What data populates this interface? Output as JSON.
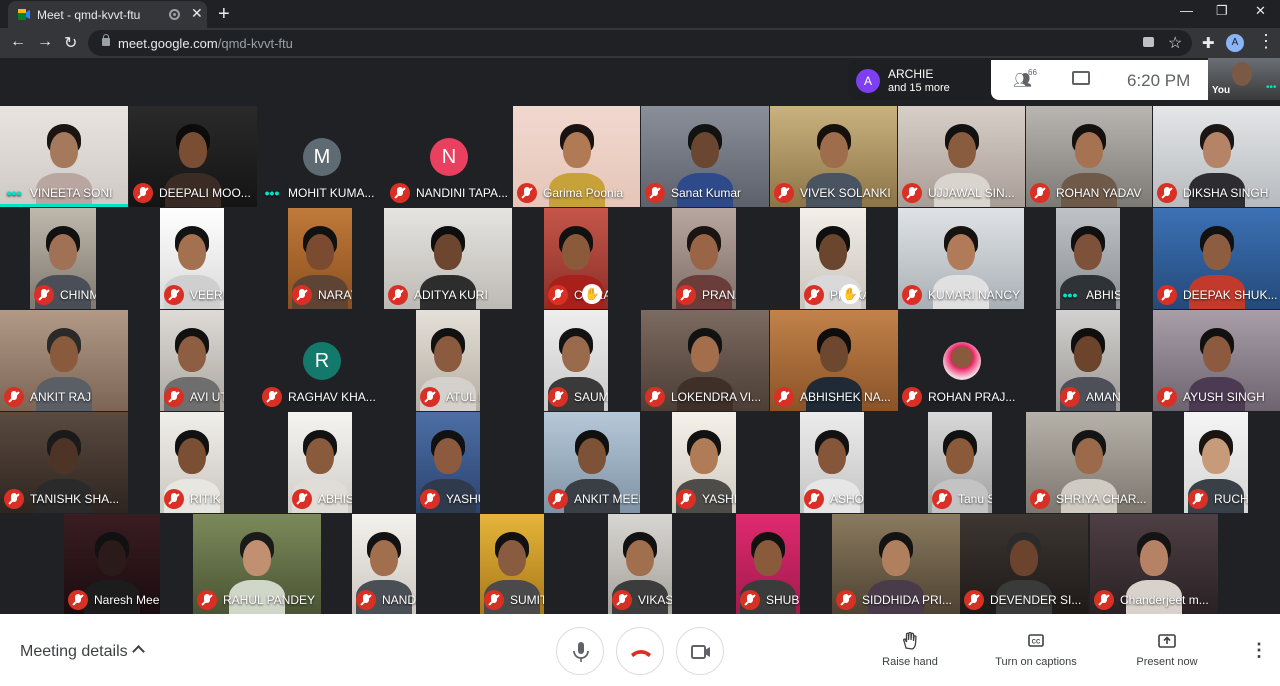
{
  "browser": {
    "tab_title": "Meet - qmd-kvvt-ftu",
    "tab_close": "✕",
    "new_tab": "+",
    "url_host": "meet.google.com",
    "url_path": "/qmd-kvvt-ftu",
    "profile_initial": "A",
    "window_min": "—",
    "window_max": "❐",
    "window_close": "✕"
  },
  "meet": {
    "presenter_initial": "A",
    "presenter_name": "ARCHIE",
    "presenter_more": "and 15 more",
    "participant_count": "66",
    "time": "6:20 PM",
    "self_label": "You",
    "accent": "#00e3c6",
    "muted_color": "#d93025"
  },
  "participants": [
    {
      "name": "VINEETA SONI",
      "status": "speaking"
    },
    {
      "name": "DEEPALI MOO...",
      "status": "muted"
    },
    {
      "name": "MOHIT KUMA...",
      "status": "speaking",
      "initial": "M"
    },
    {
      "name": "NANDINI TAPA...",
      "status": "muted",
      "initial": "N"
    },
    {
      "name": "Garima Poonia",
      "status": "muted"
    },
    {
      "name": "Sanat Kumar",
      "status": "muted"
    },
    {
      "name": "VIVEK SOLANKI",
      "status": "muted"
    },
    {
      "name": "UJJAWAL SIN...",
      "status": "muted"
    },
    {
      "name": "ROHAN YADAV",
      "status": "muted"
    },
    {
      "name": "DIKSHA SINGH",
      "status": "muted"
    },
    {
      "name": "CHINMAYA SI...",
      "status": "muted"
    },
    {
      "name": "VEERU SINGH",
      "status": "muted"
    },
    {
      "name": "NARAYAN TELI",
      "status": "muted"
    },
    {
      "name": "ADITYA KURI",
      "status": "muted"
    },
    {
      "name": "CHIRAYU ...",
      "status": "muted",
      "hand": true
    },
    {
      "name": "PRANAV SHA...",
      "status": "muted"
    },
    {
      "name": "PRAKASH ...",
      "status": "muted",
      "hand": true
    },
    {
      "name": "KUMARI NANCY",
      "status": "muted"
    },
    {
      "name": "ABHISHEK MA...",
      "status": "speaking"
    },
    {
      "name": "DEEPAK SHUK...",
      "status": "muted"
    },
    {
      "name": "ANKIT RAJ",
      "status": "muted"
    },
    {
      "name": "AVI UTTAM",
      "status": "muted"
    },
    {
      "name": "RAGHAV KHA...",
      "status": "muted",
      "initial": "R"
    },
    {
      "name": "ATUL PATIDAR",
      "status": "muted"
    },
    {
      "name": "SAUMYA SINGH",
      "status": "muted"
    },
    {
      "name": "LOKENDRA VI...",
      "status": "muted"
    },
    {
      "name": "ABHISHEK NA...",
      "status": "muted"
    },
    {
      "name": "ROHAN PRAJ...",
      "status": "muted"
    },
    {
      "name": "AMAN KHERA...",
      "status": "muted"
    },
    {
      "name": "AYUSH SINGH",
      "status": "muted"
    },
    {
      "name": "TANISHK SHA...",
      "status": "muted"
    },
    {
      "name": "RITIK SINGH S...",
      "status": "muted"
    },
    {
      "name": "ABHISHEK CH...",
      "status": "muted"
    },
    {
      "name": "YASHU KUMA...",
      "status": "muted"
    },
    {
      "name": "ANKIT MEENA",
      "status": "muted"
    },
    {
      "name": "YASHI AGRAW...",
      "status": "muted"
    },
    {
      "name": "ASHOK KUMAR",
      "status": "muted"
    },
    {
      "name": "Tanu Shree",
      "status": "muted"
    },
    {
      "name": "SHRIYA CHAR...",
      "status": "muted"
    },
    {
      "name": "RUCHITA",
      "status": "muted"
    },
    {
      "name": "Naresh Meena",
      "status": "muted"
    },
    {
      "name": "RAHUL PANDEY",
      "status": "muted"
    },
    {
      "name": "NANDAN AGG...",
      "status": "muted"
    },
    {
      "name": "SUMIT NAGAR",
      "status": "muted"
    },
    {
      "name": "VIKAS KUMAR",
      "status": "muted"
    },
    {
      "name": "SHUBHAM",
      "status": "muted"
    },
    {
      "name": "SIDDHIDA PRI...",
      "status": "muted"
    },
    {
      "name": "DEVENDER SI...",
      "status": "muted"
    },
    {
      "name": "Chanderjeet m...",
      "status": "muted"
    }
  ],
  "controls": {
    "meeting_details": "Meeting details",
    "raise_hand": "Raise hand",
    "captions": "Turn on captions",
    "present": "Present now"
  }
}
